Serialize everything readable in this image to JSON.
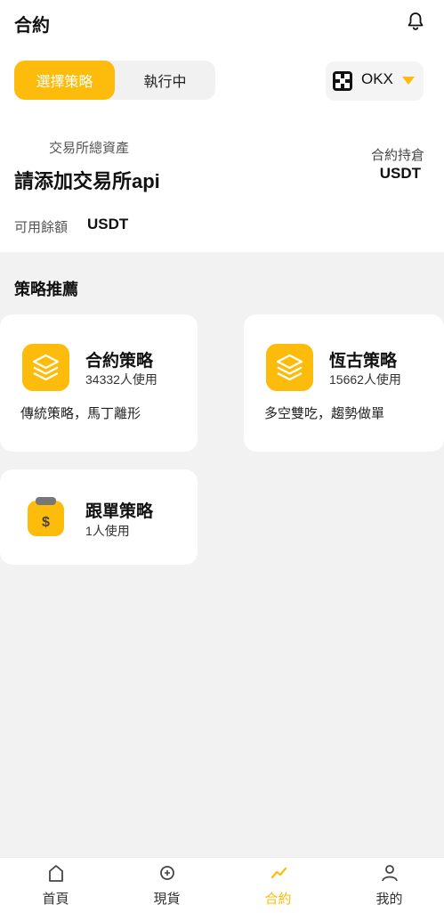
{
  "header": {
    "title": "合約"
  },
  "segment": {
    "active": "選擇策略",
    "other": "執行中"
  },
  "exchange": {
    "name": "OKX"
  },
  "account": {
    "asset_label": "交易所總資產",
    "asset_value": "請添加交易所api",
    "position_label": "合約持倉",
    "position_value": "USDT",
    "available_label": "可用餘額",
    "available_value": "USDT"
  },
  "section_title": "策略推薦",
  "strategies": [
    {
      "name": "合約策略",
      "users": "34332人使用",
      "desc": "傳統策略，馬丁離形"
    },
    {
      "name": "恆古策略",
      "users": "15662人使用",
      "desc": "多空雙吃，趨勢做單"
    },
    {
      "name": "跟單策略",
      "users": "1人使用",
      "desc": ""
    }
  ],
  "tabs": [
    {
      "label": "首頁",
      "icon": "home-icon"
    },
    {
      "label": "現貨",
      "icon": "spot-icon"
    },
    {
      "label": "合約",
      "icon": "contract-icon"
    },
    {
      "label": "我的",
      "icon": "profile-icon"
    }
  ],
  "colors": {
    "accent": "#fdbc0b",
    "background": "#f2f2f2"
  }
}
